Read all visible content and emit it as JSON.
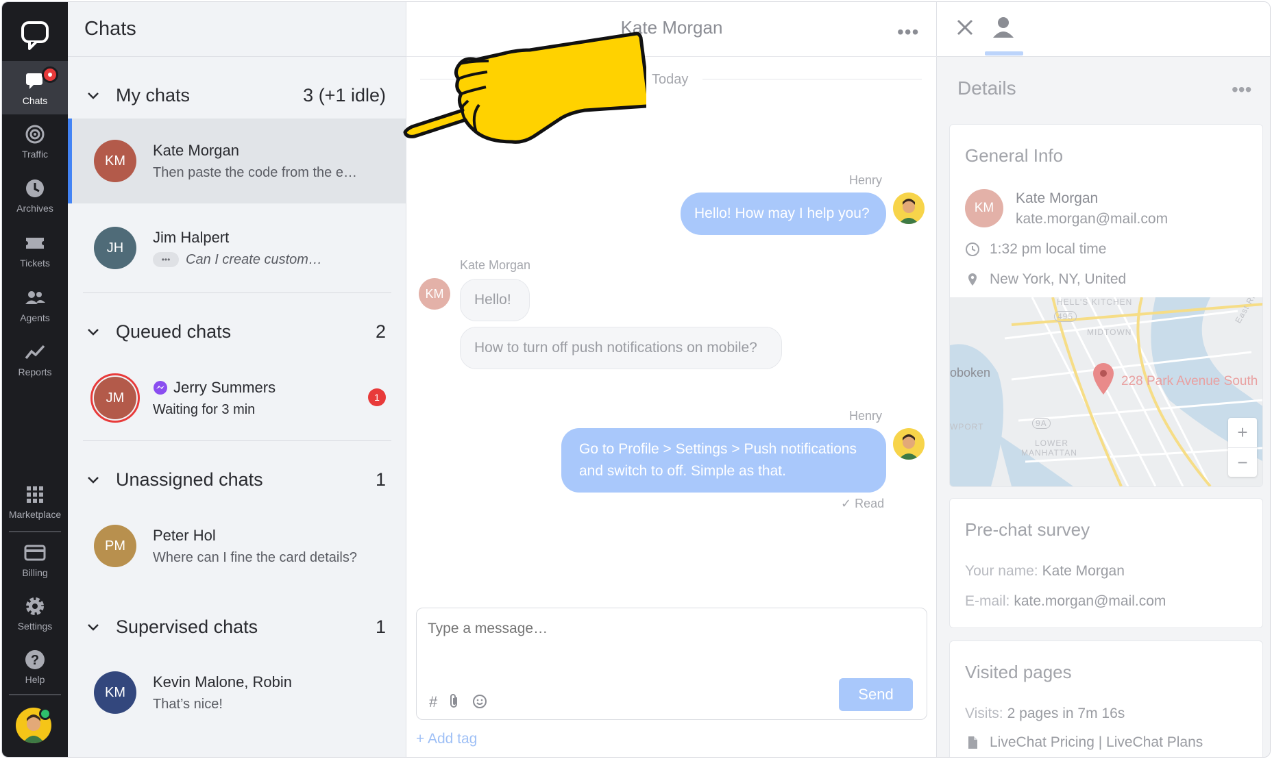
{
  "nav": {
    "items": [
      {
        "label": "Chats",
        "icon": "chats-icon"
      },
      {
        "label": "Traffic",
        "icon": "traffic-icon"
      },
      {
        "label": "Archives",
        "icon": "archives-icon"
      },
      {
        "label": "Tickets",
        "icon": "tickets-icon"
      },
      {
        "label": "Agents",
        "icon": "agents-icon"
      },
      {
        "label": "Reports",
        "icon": "reports-icon"
      },
      {
        "label": "Marketplace",
        "icon": "marketplace-icon"
      },
      {
        "label": "Billing",
        "icon": "billing-icon"
      },
      {
        "label": "Settings",
        "icon": "settings-icon"
      },
      {
        "label": "Help",
        "icon": "help-icon"
      }
    ]
  },
  "list": {
    "title": "Chats",
    "sections": [
      {
        "title": "My chats",
        "count": "3 (+1 idle)"
      },
      {
        "title": "Queued chats",
        "count": "2"
      },
      {
        "title": "Unassigned chats",
        "count": "1"
      },
      {
        "title": "Supervised chats",
        "count": "1"
      }
    ],
    "chats": [
      {
        "initials": "KM",
        "name": "Kate Morgan",
        "preview": "Then paste the code from the e…",
        "color": "#b35a4a"
      },
      {
        "initials": "JH",
        "name": "Jim Halpert",
        "preview": "Can I create custom…",
        "color": "#4f6b78"
      },
      {
        "initials": "JM",
        "name": "Jerry Summers",
        "preview": "Waiting for 3 min",
        "color": "#b35a4a",
        "badge": "1"
      },
      {
        "initials": "PM",
        "name": "Peter Hol",
        "preview": "Where can I fine the card details?",
        "color": "#b8904e"
      },
      {
        "initials": "KM",
        "name": "Kevin Malone, Robin",
        "preview": "That’s nice!",
        "color": "#33477d"
      }
    ]
  },
  "conversation": {
    "title": "Kate Morgan",
    "more": "•••",
    "date_divider": "Today",
    "messages": [
      {
        "author": "Henry",
        "text": "Hello! How may I help you?"
      },
      {
        "author": "Kate Morgan",
        "initials": "KM",
        "text": "Hello!"
      },
      {
        "text": "How to turn off push notifications on mobile?"
      },
      {
        "author": "Henry",
        "line1": "Go to Profile > Settings > Push notifications",
        "line2": "and switch to off. Simple as that."
      }
    ],
    "read_status": "Read",
    "composer_placeholder": "Type a message…",
    "send_label": "Send",
    "add_tag_label": "+ Add tag"
  },
  "details": {
    "title": "Details",
    "more": "•••",
    "general_info": {
      "title": "General Info",
      "initials": "KM",
      "name": "Kate Morgan",
      "email": "kate.morgan@mail.com",
      "local_time": "1:32 pm local time",
      "location": "New York, NY, United"
    },
    "map": {
      "pin_label": "228 Park Avenue South",
      "labels": [
        "HELL'S KITCHEN",
        "MIDTOWN",
        "oboken",
        "WPORT",
        "LOWER",
        "MANHATTAN",
        "495",
        "9A",
        "East Ri"
      ],
      "zoom_in": "+",
      "zoom_out": "−"
    },
    "pre_chat": {
      "title": "Pre-chat survey",
      "name_label": "Your name:",
      "name_value": "Kate Morgan",
      "email_label": "E-mail:",
      "email_value": "kate.morgan@mail.com"
    },
    "visited": {
      "title": "Visited pages",
      "visits_label": "Visits:",
      "visits_value": "2 pages in 7m 16s",
      "page": "LiveChat Pricing | LiveChat Plans"
    }
  },
  "colors": {
    "accent": "#4384f5",
    "nav_bg": "#1c1d21",
    "bubble_out": "#a9c8fb",
    "badge": "#e83a3a",
    "pointer_hand": "#ffd200"
  }
}
